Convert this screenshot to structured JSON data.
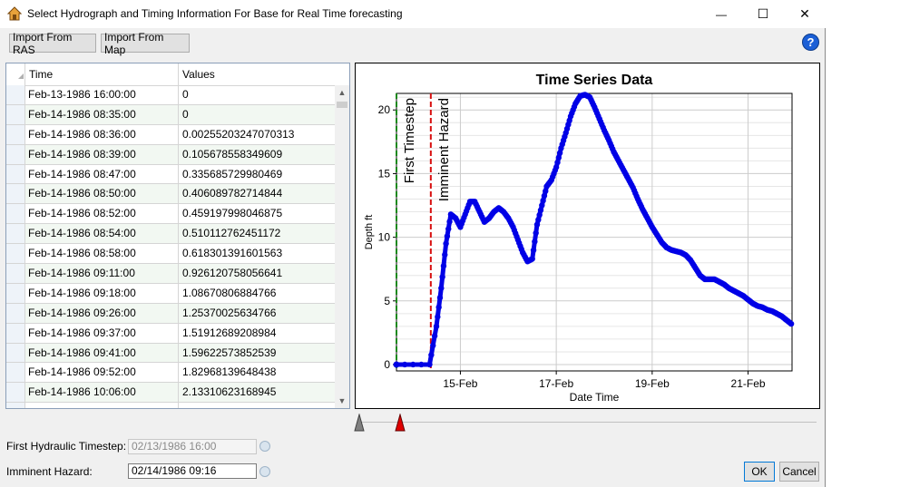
{
  "window": {
    "title": "Select Hydrograph and Timing Information For Base for Real Time forecasting",
    "minimize_glyph": "—",
    "maximize_glyph": "☐",
    "close_glyph": "✕"
  },
  "toolbar": {
    "import_ras_label": "Import From RAS",
    "import_map_label": "Import From Map",
    "help_glyph": "?"
  },
  "table": {
    "columns": [
      "Time",
      "Values"
    ],
    "rows": [
      {
        "time": "Feb-13-1986 16:00:00",
        "value": "0"
      },
      {
        "time": "Feb-14-1986 08:35:00",
        "value": "0"
      },
      {
        "time": "Feb-14-1986 08:36:00",
        "value": "0.00255203247070313"
      },
      {
        "time": "Feb-14-1986 08:39:00",
        "value": "0.105678558349609"
      },
      {
        "time": "Feb-14-1986 08:47:00",
        "value": "0.335685729980469"
      },
      {
        "time": "Feb-14-1986 08:50:00",
        "value": "0.406089782714844"
      },
      {
        "time": "Feb-14-1986 08:52:00",
        "value": "0.459197998046875"
      },
      {
        "time": "Feb-14-1986 08:54:00",
        "value": "0.510112762451172"
      },
      {
        "time": "Feb-14-1986 08:58:00",
        "value": "0.618301391601563"
      },
      {
        "time": "Feb-14-1986 09:11:00",
        "value": "0.926120758056641"
      },
      {
        "time": "Feb-14-1986 09:18:00",
        "value": "1.08670806884766"
      },
      {
        "time": "Feb-14-1986 09:26:00",
        "value": "1.25370025634766"
      },
      {
        "time": "Feb-14-1986 09:37:00",
        "value": "1.51912689208984"
      },
      {
        "time": "Feb-14-1986 09:41:00",
        "value": "1.59622573852539"
      },
      {
        "time": "Feb-14-1986 09:52:00",
        "value": "1.82968139648438"
      },
      {
        "time": "Feb-14-1986 10:06:00",
        "value": "2.13310623168945"
      },
      {
        "time": "",
        "value": ""
      }
    ]
  },
  "chart_data": {
    "type": "scatter",
    "title": "Time Series Data",
    "xlabel": "Date Time",
    "ylabel": "Depth ft",
    "x_ticks": [
      "15-Feb",
      "17-Feb",
      "19-Feb",
      "21-Feb"
    ],
    "x_tick_values": [
      15,
      17,
      19,
      21
    ],
    "y_ticks": [
      "0",
      "5",
      "10",
      "15",
      "20"
    ],
    "y_tick_values": [
      0,
      5,
      10,
      15,
      20
    ],
    "xlim": [
      13.667,
      21.917
    ],
    "ylim": [
      -0.5,
      21.3
    ],
    "grid": true,
    "series_color": "#0000e6",
    "series": [
      {
        "x": [
          13.667,
          14.357,
          14.5,
          14.6,
          14.7,
          14.8,
          14.9,
          15.0,
          15.1,
          15.2,
          15.3,
          15.4,
          15.5,
          15.6,
          15.7,
          15.8,
          15.9,
          16.0,
          16.1,
          16.2,
          16.3,
          16.4,
          16.5,
          16.6,
          16.7,
          16.8,
          16.9,
          17.0,
          17.1,
          17.2,
          17.3,
          17.4,
          17.5,
          17.6,
          17.7,
          17.8,
          17.9,
          18.0,
          18.1,
          18.2,
          18.3,
          18.4,
          18.5,
          18.6,
          18.7,
          18.8,
          18.9,
          19.0,
          19.1,
          19.2,
          19.3,
          19.4,
          19.5,
          19.6,
          19.7,
          19.8,
          19.9,
          20.0,
          20.1,
          20.2,
          20.3,
          20.4,
          20.5,
          20.6,
          20.7,
          20.8,
          20.9,
          21.0,
          21.1,
          21.2,
          21.3,
          21.4,
          21.5,
          21.6,
          21.7,
          21.8,
          21.9
        ],
        "y": [
          0,
          0,
          3.0,
          6.0,
          9.5,
          11.8,
          11.5,
          10.8,
          11.8,
          12.8,
          12.8,
          12.0,
          11.2,
          11.5,
          12.0,
          12.3,
          12.0,
          11.5,
          10.8,
          9.8,
          8.8,
          8.1,
          8.3,
          11.0,
          12.5,
          14.0,
          14.5,
          15.5,
          17.0,
          18.2,
          19.5,
          20.5,
          21.1,
          21.2,
          21.0,
          20.2,
          19.3,
          18.4,
          17.6,
          16.7,
          16.0,
          15.3,
          14.6,
          13.9,
          13.0,
          12.2,
          11.5,
          10.8,
          10.2,
          9.6,
          9.2,
          9.0,
          8.9,
          8.8,
          8.6,
          8.2,
          7.6,
          7.0,
          6.7,
          6.7,
          6.7,
          6.5,
          6.3,
          6.0,
          5.8,
          5.6,
          5.4,
          5.1,
          4.8,
          4.6,
          4.5,
          4.3,
          4.2,
          4.0,
          3.8,
          3.5,
          3.2
        ]
      }
    ],
    "markers": [
      {
        "name": "First Timestep",
        "x": 13.667,
        "color": "#1a8a1a"
      },
      {
        "name": "Imminent Hazard",
        "x": 14.383,
        "color": "#d81010"
      }
    ]
  },
  "slider": {
    "first_color": "#808080",
    "hazard_color": "#e00000"
  },
  "form": {
    "first_label": "First Hydraulic Timestep:",
    "first_value": "02/13/1986 16:00",
    "hazard_label": "Imminent Hazard:",
    "hazard_value": "02/14/1986 09:16"
  },
  "buttons": {
    "ok_label": "OK",
    "cancel_label": "Cancel"
  }
}
